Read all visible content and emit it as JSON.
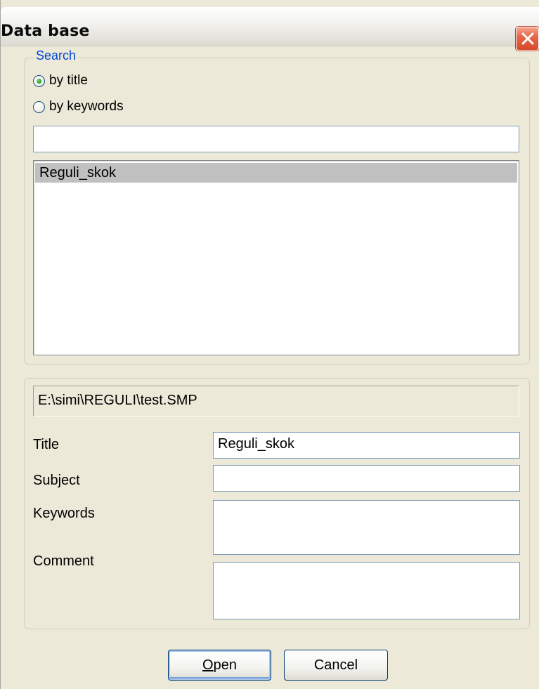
{
  "window": {
    "title": "Data base"
  },
  "search": {
    "legend": "Search",
    "options": [
      {
        "label": "by title",
        "checked": true
      },
      {
        "label": "by keywords",
        "checked": false
      }
    ],
    "query_value": "",
    "results": [
      "Reguli_skok"
    ]
  },
  "details": {
    "file_path": "E:\\simi\\REGULI\\test.SMP",
    "title_label": "Title",
    "title_value": "Reguli_skok",
    "subject_label": "Subject",
    "subject_value": "",
    "keywords_label": "Keywords",
    "keywords_value": "",
    "comment_label": "Comment",
    "comment_value": ""
  },
  "buttons": {
    "open_mnemonic": "O",
    "open_rest": "pen",
    "cancel": "Cancel"
  },
  "colors": {
    "window_bg": "#ece9d8",
    "legend_text": "#0046d5",
    "selection_bg": "#c0c0c0",
    "close_button": "#d64a2c"
  },
  "icons": {
    "close": "close-x-icon"
  }
}
